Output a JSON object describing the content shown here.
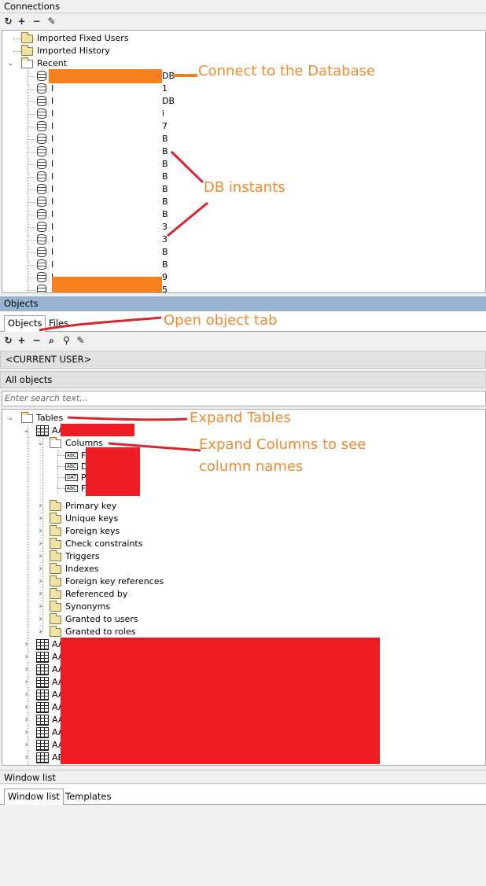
{
  "connections": {
    "title": "Connections",
    "toolbar": [
      {
        "icon": "refresh-icon",
        "glyph": "↻"
      },
      {
        "icon": "add-icon",
        "glyph": "+"
      },
      {
        "icon": "remove-icon",
        "glyph": "−"
      },
      {
        "icon": "edit-icon",
        "glyph": "✎"
      }
    ],
    "tree": {
      "imported_fixed_users": "Imported Fixed Users",
      "imported_history": "Imported History",
      "recent": "Recent",
      "db_suffixes": [
        "DB",
        "1",
        "DB",
        "i",
        "7",
        "B",
        "B",
        "B",
        "B",
        "B",
        "B",
        "B",
        "3",
        "3",
        "B",
        "B",
        "9",
        "5"
      ]
    }
  },
  "objects": {
    "title": "Objects",
    "tabs": [
      "Objects",
      "Files"
    ],
    "toolbar": [
      {
        "icon": "refresh-icon",
        "glyph": "↻"
      },
      {
        "icon": "add-icon",
        "glyph": "+"
      },
      {
        "icon": "remove-icon",
        "glyph": "−"
      },
      {
        "icon": "find-icon",
        "glyph": "⌕"
      },
      {
        "icon": "filter-icon",
        "glyph": "⚲"
      },
      {
        "icon": "edit-icon",
        "glyph": "✎"
      }
    ],
    "user_selector": "<CURRENT USER>",
    "type_selector": "All objects",
    "search_placeholder": "Enter search text...",
    "tree": {
      "tables": "Tables",
      "first_table_prefix": "AA",
      "columns": "Columns",
      "column_prefixes": [
        "F",
        "D",
        "P",
        "F"
      ],
      "column_types": [
        "ABC",
        "ABC",
        "DAT",
        "ABC"
      ],
      "subfolders": [
        "Primary key",
        "Unique keys",
        "Foreign keys",
        "Check constraints",
        "Triggers",
        "Indexes",
        "Foreign key references",
        "Referenced by",
        "Synonyms",
        "Granted to users",
        "Granted to roles"
      ],
      "other_table_prefixes": [
        "AA",
        "AA",
        "AA",
        "AA",
        "AA",
        "AA",
        "AA",
        "AA",
        "AA",
        "AE"
      ]
    }
  },
  "window_list": {
    "title": "Window list",
    "tabs": [
      "Window list",
      "Templates"
    ]
  },
  "annotations": {
    "connect": "Connect to the Database",
    "db_instants": "DB instants",
    "open_object_tab": "Open object tab",
    "expand_tables": "Expand Tables",
    "expand_columns_line1": "Expand Columns to see",
    "expand_columns_line2": "column names"
  },
  "colors": {
    "annotation_text": "#f28a30",
    "redaction_orange": "#f7811f",
    "redaction_red": "#ee1c25",
    "annotation_line": "#d8262c",
    "objects_header": "#99b4d1"
  }
}
